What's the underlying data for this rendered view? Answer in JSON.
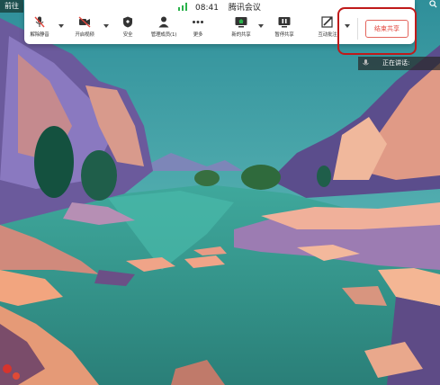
{
  "topbar": {
    "left_label": "前往",
    "right_icon": "search-icon"
  },
  "toolbar": {
    "time": "08:41",
    "title": "腾讯会议",
    "signal_color": "#2bb24c",
    "buttons": [
      {
        "label": "解除静音",
        "icon": "mic-muted-icon",
        "has_caret": true
      },
      {
        "label": "开启视频",
        "icon": "video-off-icon",
        "has_caret": true
      },
      {
        "label": "安全",
        "icon": "shield-icon",
        "has_caret": false
      },
      {
        "label": "管理成员(1)",
        "icon": "person-icon",
        "has_caret": false
      },
      {
        "label": "更多",
        "icon": "more-dots-icon",
        "has_caret": false
      },
      {
        "label": "新的共享",
        "icon": "screen-share-icon",
        "has_caret": true
      },
      {
        "label": "暂停共享",
        "icon": "pause-icon",
        "has_caret": false
      },
      {
        "label": "互动批注",
        "icon": "annotate-icon",
        "has_caret": true
      }
    ],
    "end_share_label": "结束共享",
    "end_share_color": "#e3463d"
  },
  "speaker_panel": {
    "label": "正在讲话:"
  },
  "highlight_color": "#c01a1a"
}
